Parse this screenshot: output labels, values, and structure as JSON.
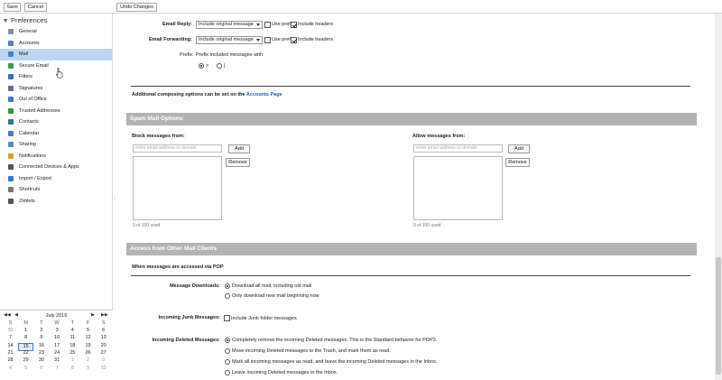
{
  "toolbar": {
    "save": "Save",
    "cancel": "Cancel",
    "undo": "Undo Changes"
  },
  "sidebar": {
    "heading": "Preferences",
    "items": [
      {
        "label": "General",
        "icon": "general-icon",
        "color": "#7a8fa8"
      },
      {
        "label": "Accounts",
        "icon": "accounts-icon",
        "color": "#5a7fb0"
      },
      {
        "label": "Mail",
        "icon": "mail-icon",
        "color": "#4a82c0"
      },
      {
        "label": "Secure Email",
        "icon": "secure-email-icon",
        "color": "#3a9b4a"
      },
      {
        "label": "Filters",
        "icon": "filters-icon",
        "color": "#3a6fb8"
      },
      {
        "label": "Signatures",
        "icon": "signatures-icon",
        "color": "#6a6a9a"
      },
      {
        "label": "Out of Office",
        "icon": "out-of-office-icon",
        "color": "#3a7ac0"
      },
      {
        "label": "Trusted Addresses",
        "icon": "trusted-addresses-icon",
        "color": "#2e9a3e"
      },
      {
        "label": "Contacts",
        "icon": "contacts-icon",
        "color": "#3a6aa8"
      },
      {
        "label": "Calendar",
        "icon": "calendar-icon",
        "color": "#4a7ab8"
      },
      {
        "label": "Sharing",
        "icon": "sharing-icon",
        "color": "#5a8ac0"
      },
      {
        "label": "Notifications",
        "icon": "notifications-icon",
        "color": "#e0a020"
      },
      {
        "label": "Connected Devices & Apps",
        "icon": "devices-icon",
        "color": "#555555"
      },
      {
        "label": "Import / Export",
        "icon": "import-export-icon",
        "color": "#3a7ac0"
      },
      {
        "label": "Shortcuts",
        "icon": "shortcuts-icon",
        "color": "#777777"
      },
      {
        "label": "Zimlets",
        "icon": "zimlets-icon",
        "color": "#555555"
      }
    ]
  },
  "calendar": {
    "title": "July 2019",
    "prev_year": "◀◀",
    "prev": "◀",
    "next": "▶",
    "next_year": "▶▶",
    "dow": [
      "S",
      "M",
      "T",
      "W",
      "T",
      "F",
      "S"
    ],
    "weeks": [
      [
        "30",
        "1",
        "2",
        "3",
        "4",
        "5",
        "6"
      ],
      [
        "7",
        "8",
        "9",
        "10",
        "11",
        "12",
        "13"
      ],
      [
        "14",
        "15",
        "16",
        "17",
        "18",
        "19",
        "20"
      ],
      [
        "21",
        "22",
        "23",
        "24",
        "25",
        "26",
        "27"
      ],
      [
        "28",
        "29",
        "30",
        "31",
        "1",
        "2",
        "3"
      ],
      [
        "4",
        "5",
        "6",
        "7",
        "8",
        "9",
        "10"
      ]
    ]
  },
  "reply": {
    "label": "Email Reply:",
    "value": "Include original message",
    "use_prefix": "Use prefix",
    "include_headers": "Include headers"
  },
  "forward": {
    "label": "Email Forwarding:",
    "value": "Include original message",
    "use_prefix": "Use prefix",
    "include_headers": "Include headers"
  },
  "prefix": {
    "label": "Prefix:",
    "text": "Prefix included messages with:",
    "opt1": ">",
    "opt2": "|"
  },
  "composing_note": "Additional composing options can be set on the",
  "accounts_link": "Accounts Page",
  "spam": {
    "title": "Spam Mail Options",
    "block_label": "Block messages from:",
    "allow_label": "Allow messages from:",
    "placeholder": "enter email address or domain",
    "add": "Add",
    "remove": "Remove",
    "block_count": "0 of 100 used.",
    "allow_count": "0 of 100 used."
  },
  "access": {
    "title": "Access from Other Mail Clients",
    "subtitle": "When messages are accessed via POP",
    "downloads_label": "Message Downloads:",
    "download_all": "Download all mail, including old mail",
    "download_new": "Only download new mail beginning now",
    "junk_label": "Incoming Junk Messages:",
    "junk_option": "Include Junk folder messages",
    "deleted_label": "Incoming Deleted Messages:",
    "deleted_options": [
      "Completely remove the incoming Deleted messages. This is the Standard behavior for POP3.",
      "Move incoming Deleted messages to the Trash, and mark them as read.",
      "Mark all incoming messages as read, and leave the incoming Deleted messages in the Inbox.",
      "Leave incoming Deleted messages in the Inbox."
    ]
  }
}
